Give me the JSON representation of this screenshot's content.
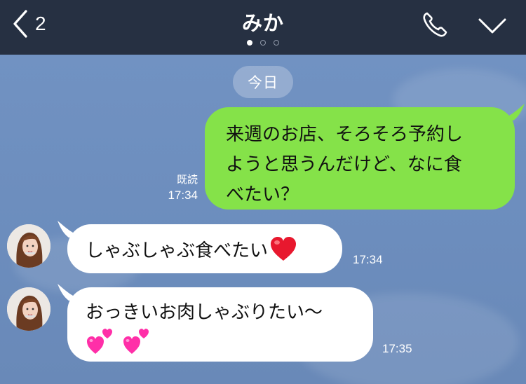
{
  "header": {
    "back_count": "2",
    "title": "みか",
    "page_dots": 3,
    "active_dot": 0,
    "icons": {
      "back": "chevron-left-icon",
      "call": "phone-icon",
      "menu": "chevron-down-icon"
    }
  },
  "chat": {
    "date_label": "今日",
    "messages": [
      {
        "direction": "outgoing",
        "lines": [
          "来週のお店、そろそろ予約し",
          "ようと思うんだけど、なに食",
          "べたい？"
        ],
        "read_label": "既読",
        "time": "17:34"
      },
      {
        "direction": "incoming",
        "text": "しゃぶしゃぶ食べたい",
        "emoji": [
          "red-heart"
        ],
        "time": "17:34"
      },
      {
        "direction": "incoming",
        "text": "おっきいお肉しゃぶりたい〜",
        "emoji": [
          "two-hearts",
          "two-hearts"
        ],
        "time": "17:35"
      }
    ]
  },
  "colors": {
    "header_bg": "#263042",
    "chat_bg": "#6f8fbf",
    "outgoing_bubble": "#85e249",
    "incoming_bubble": "#ffffff",
    "heart_red": "#e8182e",
    "heart_pink": "#ff2fa8"
  }
}
